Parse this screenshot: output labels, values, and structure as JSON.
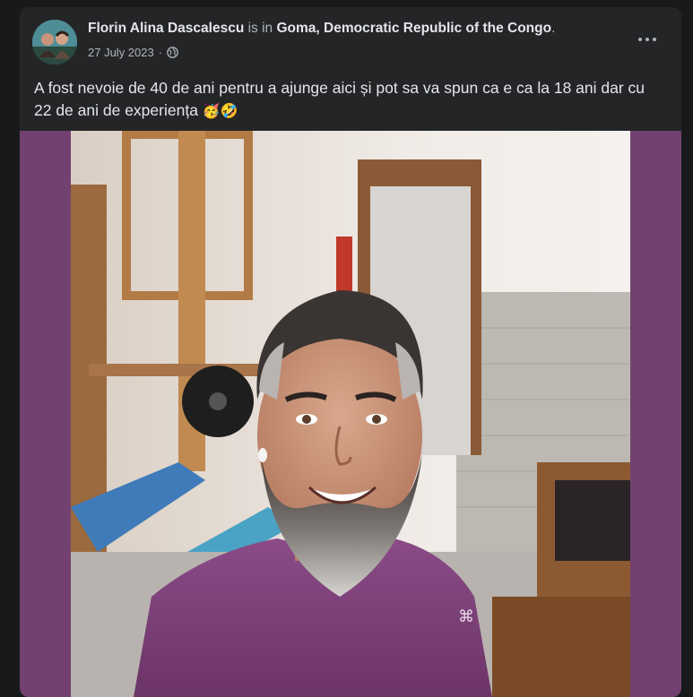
{
  "post": {
    "author": "Florin Alina Dascalescu",
    "location_prefix": "is in",
    "location": "Goma, Democratic Republic of the Congo",
    "location_suffix": ".",
    "date": "27 July 2023",
    "separator": "·",
    "audience_icon": "globe-icon",
    "more_icon": "more-options-icon",
    "text": "A fost nevoie de 40 de ani pentru a ajunge aici și pot sa va spun ca e ca la 18 ani dar cu 22 de ani de experiența",
    "emojis": "🥳🤣"
  },
  "colors": {
    "background": "#18191a",
    "card": "#242526",
    "primary_text": "#e4e6eb",
    "secondary_text": "#b0b3b8",
    "photo_matte": "#734170"
  }
}
